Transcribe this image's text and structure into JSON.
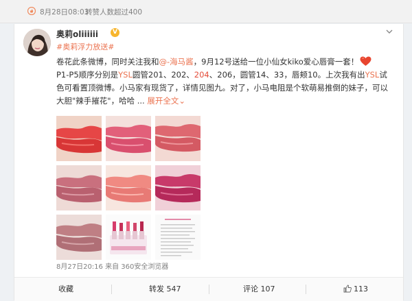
{
  "topbar": {
    "date": "8月28日08:03",
    "repost_note": "转赞人数超过400"
  },
  "post": {
    "username": "奥莉oliiiiii",
    "topic": "#奥莉浮力放送#",
    "text": {
      "p1": "卷花此条微博，同时关注我和",
      "mention": "@-海马酱",
      "p2": "，9月12号送给一位小仙女kiko爱心唇膏一套！",
      "p3": "P1-P5顺序分别是",
      "brand1": "YSL",
      "p4": "圆管201、202、",
      "red_num": "204",
      "p5": "、206，圆管14、33，唇颊10。上次我有出",
      "brand2": "YSL",
      "p6": "试色可看置顶微博。小马家有现货了，详情见图九。对了，小马电阻是个软萌易推倒的妹子，可以大胆\"辣手摧花\"，哈哈 ...",
      "expand": "展开全文",
      "expand_chev": "⌄"
    },
    "meta": "8月27日20:16 来自 360安全浏览器"
  },
  "actions": {
    "favorite": "收藏",
    "repost": "转发 547",
    "comment": "评论 107",
    "like": "113"
  }
}
